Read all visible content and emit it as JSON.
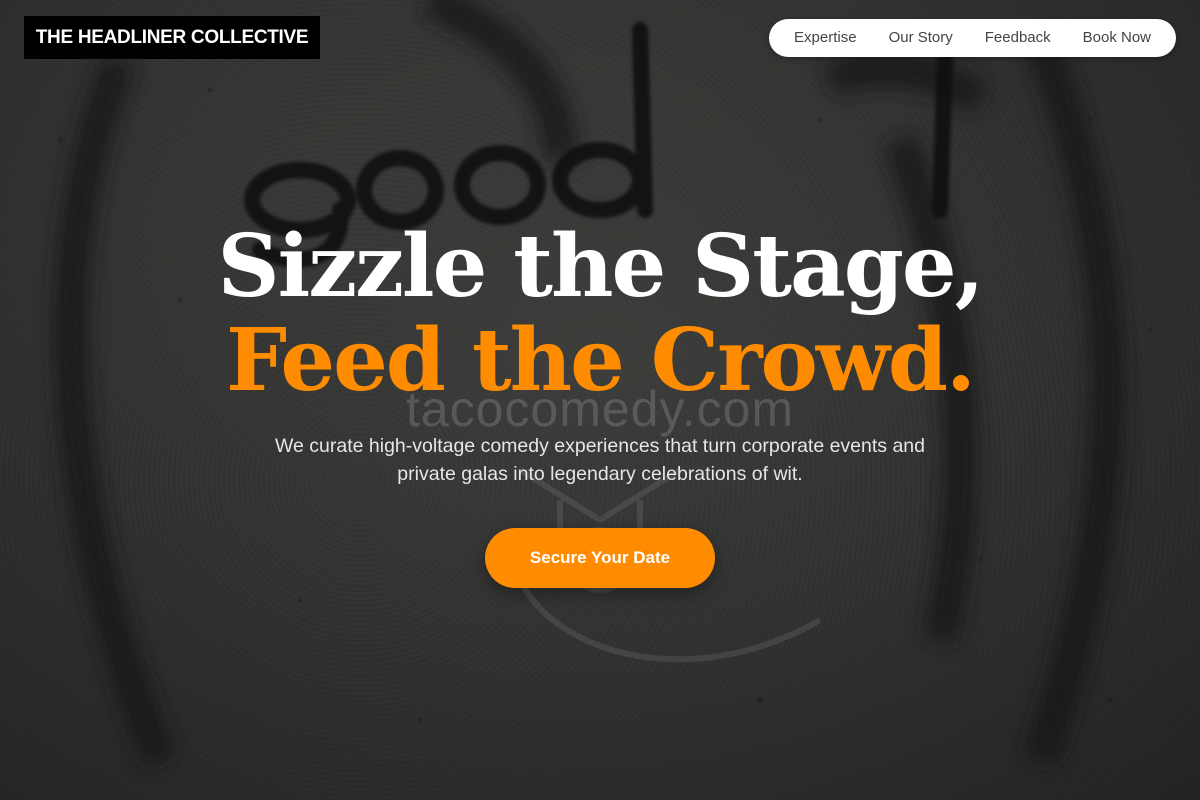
{
  "brand": {
    "logo_text": "THE HEADLINER COLLECTIVE"
  },
  "nav": {
    "items": [
      {
        "label": "Expertise"
      },
      {
        "label": "Our Story"
      },
      {
        "label": "Feedback"
      },
      {
        "label": "Book Now"
      }
    ]
  },
  "hero": {
    "headline_line1": "Sizzle the Stage,",
    "headline_line2": "Feed the Crowd.",
    "subtitle": "We curate high-voltage comedy experiences that turn corporate events and private galas into legendary celebrations of wit.",
    "cta_label": "Secure Your Date",
    "background_watermark": "tacocomedy.com"
  },
  "colors": {
    "accent": "#ff8c00",
    "logo_bg": "#000000",
    "nav_bg": "#ffffff"
  }
}
